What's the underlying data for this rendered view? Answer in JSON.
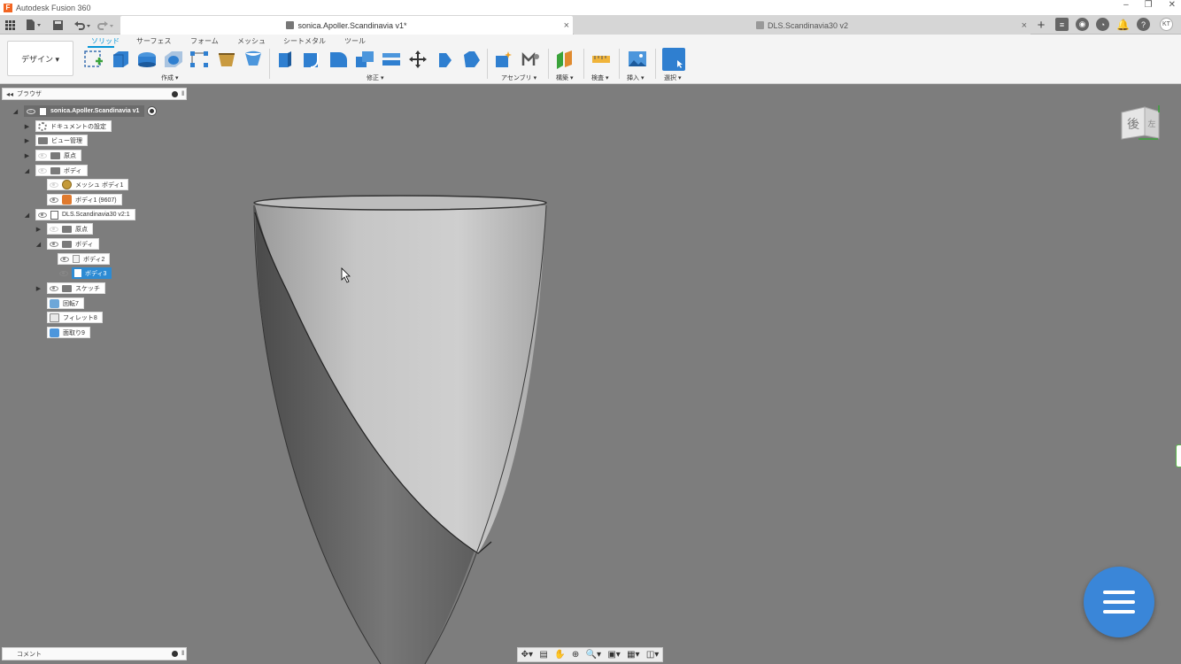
{
  "titlebar": {
    "title": "Autodesk Fusion 360",
    "logo": "F",
    "controls": [
      "–",
      "❐",
      "✕"
    ]
  },
  "tabs": [
    {
      "label": "sonica.Apoller.Scandinavia v1*",
      "active": true
    },
    {
      "label": "DLS.Scandinavia30 v2",
      "active": false
    }
  ],
  "header_user": "KT",
  "toolbar": {
    "workspace": "デザイン ▾",
    "ws_tabs": [
      "ソリッド",
      "サーフェス",
      "フォーム",
      "メッシュ",
      "シートメタル",
      "ツール"
    ],
    "group_labels": [
      "作成 ▾",
      "修正 ▾",
      "アセンブリ ▾",
      "構築 ▾",
      "検査 ▾",
      "挿入 ▾",
      "選択 ▾"
    ]
  },
  "browser": {
    "title": "ブラウザ",
    "items": [
      {
        "label": "sonica.Apoller.Scandinavia v1"
      },
      {
        "label": "ドキュメントの設定"
      },
      {
        "label": "ビュー管理"
      },
      {
        "label": "原点"
      },
      {
        "label": "ボディ"
      },
      {
        "label": "メッシュ ボディ1"
      },
      {
        "label": "ボディ1 (9607)"
      },
      {
        "label": "DLS.Scandinavia30 v2:1"
      },
      {
        "label": "原点"
      },
      {
        "label": "ボディ"
      },
      {
        "label": "ボディ2"
      },
      {
        "label": "ボディ3"
      },
      {
        "label": "スケッチ"
      },
      {
        "label": "回転7"
      },
      {
        "label": "フィレット8"
      },
      {
        "label": "面取り9"
      }
    ]
  },
  "viewcube": {
    "face": "後",
    "side": "左"
  },
  "comments": {
    "label": "コメント"
  },
  "colors": {
    "accent": "#0696d7",
    "selected": "#2d8bd3",
    "fab": "#3a86d8",
    "canvas": "#7d7d7d"
  }
}
